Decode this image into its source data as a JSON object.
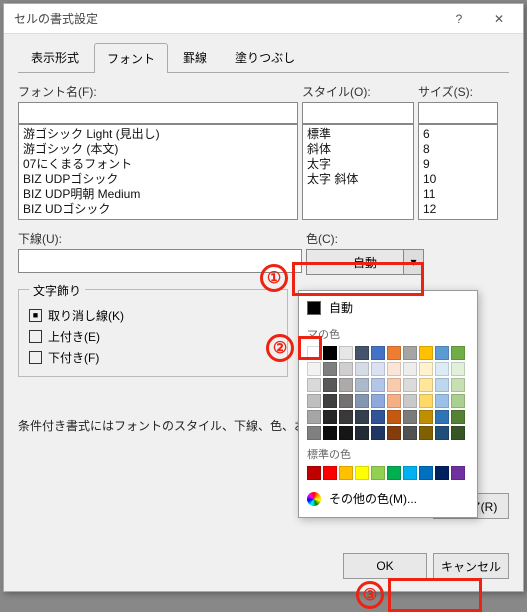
{
  "title": "セルの書式設定",
  "tabs": [
    "表示形式",
    "フォント",
    "罫線",
    "塗りつぶし"
  ],
  "activeTab": 1,
  "labels": {
    "fontName": "フォント名(F):",
    "style": "スタイル(O):",
    "size": "サイズ(S):",
    "underline": "下線(U):",
    "color": "色(C):",
    "decor": "文字飾り",
    "strike": "取り消し線(K)",
    "sup": "上付き(E)",
    "sub": "下付き(F)",
    "note": "条件付き書式にはフォントのスタイル、下線、色、および取り",
    "clear": "クリア(R)",
    "ok": "OK",
    "cancel": "キャンセル",
    "auto": "自動",
    "themeColors": "マの色",
    "stdColors": "標準の色",
    "otherColors": "その他の色(M)..."
  },
  "fontList": [
    "游ゴシック Light (見出し)",
    "游ゴシック (本文)",
    "07にくまるフォント",
    "BIZ UDPゴシック",
    "BIZ UDP明朝 Medium",
    "BIZ UDゴシック"
  ],
  "styleList": [
    "標準",
    "斜体",
    "太字",
    "太字 斜体"
  ],
  "sizeList": [
    "6",
    "8",
    "9",
    "10",
    "11",
    "12"
  ],
  "colorSelect": "自動",
  "themeSwatches": [
    "#ffffff",
    "#000000",
    "#e7e6e6",
    "#44546a",
    "#4472c4",
    "#ed7d31",
    "#a5a5a5",
    "#ffc000",
    "#5b9bd5",
    "#70ad47",
    "#f2f2f2",
    "#7f7f7f",
    "#d0cece",
    "#d6dce5",
    "#d9e1f2",
    "#fce4d6",
    "#ededed",
    "#fff2cc",
    "#ddebf7",
    "#e2efda",
    "#d9d9d9",
    "#595959",
    "#aeaaaa",
    "#acb9ca",
    "#b4c6e7",
    "#f8cbad",
    "#dbdbdb",
    "#ffe699",
    "#bdd7ee",
    "#c6e0b4",
    "#bfbfbf",
    "#404040",
    "#757171",
    "#8497b0",
    "#8ea9db",
    "#f4b084",
    "#c9c9c9",
    "#ffd966",
    "#9bc2e6",
    "#a9d08e",
    "#a6a6a6",
    "#262626",
    "#3a3838",
    "#333f4f",
    "#305496",
    "#c65911",
    "#7b7b7b",
    "#bf8f00",
    "#2f75b5",
    "#548235",
    "#808080",
    "#0d0d0d",
    "#161616",
    "#222b35",
    "#203764",
    "#833c0c",
    "#525252",
    "#806000",
    "#1f4e78",
    "#375623"
  ],
  "stdSwatches": [
    "#c00000",
    "#ff0000",
    "#ffc000",
    "#ffff00",
    "#92d050",
    "#00b050",
    "#00b0f0",
    "#0070c0",
    "#002060",
    "#7030a0"
  ]
}
